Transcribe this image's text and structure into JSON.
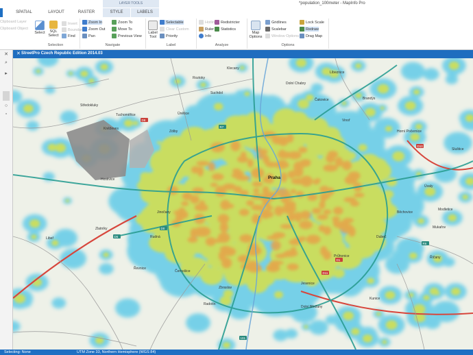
{
  "window": {
    "title": "*population_100meter - MapInfo Pro"
  },
  "context_tab_group": "LAYER TOOLS",
  "tabs": [
    {
      "label": "SPATIAL"
    },
    {
      "label": "LAYOUT"
    },
    {
      "label": "RASTER"
    },
    {
      "label": "STYLE"
    },
    {
      "label": "LABELS"
    }
  ],
  "ribbon": {
    "groups": {
      "selection": "Selection",
      "navigate": "Navigate",
      "label": "Label",
      "analyze": "Analyze",
      "options": "Options"
    },
    "left_cut": {
      "item1": "Clipboard Layer",
      "item2": "Clipboard Object"
    },
    "select": "Select",
    "sql_select": "SQL Select",
    "invert": "Invert",
    "boundary": "Boundary",
    "find": "Find",
    "zoom_in": "Zoom In",
    "zoom_out": "Zoom Out",
    "pan": "Pan",
    "zoom_to": "Zoom To",
    "move_to": "Move To",
    "previous_view": "Previous View",
    "label_tool": "Label Tool",
    "selectable": "Selectable",
    "clear_custom": "Clear Custom",
    "priority": "Priority",
    "ruler": "Ruler",
    "info": "Info",
    "redistricter": "Redistricter",
    "statistics": "Statistics",
    "hotlink": "Hotlink",
    "map_options": "Map Options",
    "gridlines": "Gridlines",
    "scalebar": "Scalebar",
    "window_options": "Window Options",
    "lock_scale": "Lock Scale",
    "redraw": "Redraw",
    "drag_map": "Drag Map"
  },
  "map": {
    "tab_title": "StreetPro Czech Republic Edition 2014.03",
    "city_label": "Praha",
    "place_labels": [
      "Hostivice",
      "Klecany",
      "Roztoky",
      "Suchdol",
      "Dolní Chabry",
      "Líbeznice",
      "Brandýs",
      "Čakovice",
      "Vinoř",
      "Horní Počernice",
      "Úvaly",
      "Běchovice",
      "Dubeč",
      "Říčany",
      "Průhonice",
      "Jesenice",
      "Zbraslav",
      "Černošice",
      "Řevnice",
      "Rudná",
      "Jinočany",
      "Kněževes",
      "Tuchoměřice",
      "Středokluky",
      "Únětice",
      "Zdiby",
      "Zlatníky",
      "Libeř",
      "Radotín",
      "Dolní Břežany",
      "Mukařov",
      "Sluštice",
      "Kunice",
      "Modletice"
    ],
    "road_labels": [
      "D8",
      "D10",
      "D11",
      "D1",
      "D5",
      "D0",
      "R7",
      "R6",
      "101"
    ]
  },
  "status": {
    "left": "Selecting: None",
    "mid": "UTM Zone 33, Northern Hemisphere (WGS 84)"
  },
  "colors": {
    "accent": "#1e6fc3",
    "heat_low": "#4fc6e8",
    "heat_mid": "#d8e04a",
    "heat_high": "#e6a24a",
    "airport": "#8c8c8c"
  }
}
